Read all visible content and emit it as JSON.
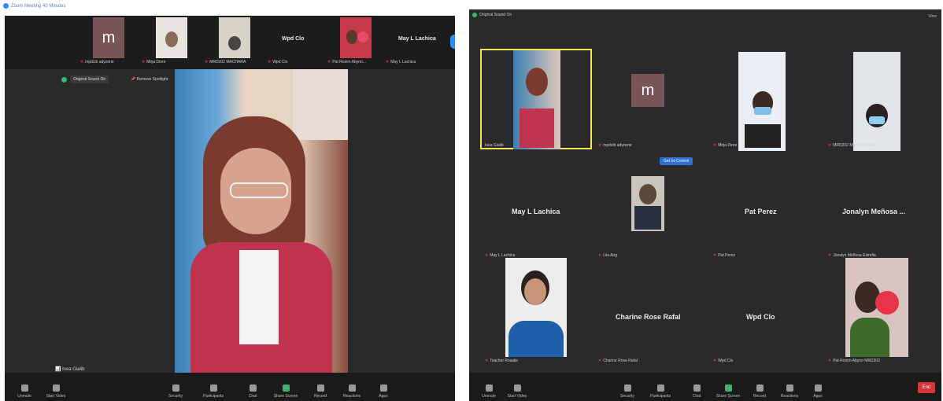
{
  "left": {
    "window_title": "Zoom Meeting 40 Minutes",
    "thumbs": [
      {
        "avatar_letter": "m",
        "name": "mpdcib adyzerie"
      },
      {
        "name": "Mirja Diore"
      },
      {
        "name": "MRD202 MACHARA"
      },
      {
        "big_name": "Wpd Clo",
        "name": "Wpd Clo"
      },
      {
        "name": "Pat Ronim Abyno..."
      },
      {
        "big_name": "May L Lachica",
        "name": "May L Lachica"
      }
    ],
    "original_sound": "Original Sound On",
    "remove_spotlight": "Remove Spotlight",
    "speaker_name": "Isea Gialib",
    "toolbar": [
      "Unmute",
      "Start Video",
      "Security",
      "Participants",
      "Chat",
      "Share Screen",
      "Record",
      "Reactions",
      "Apps"
    ],
    "participants_count": "11"
  },
  "right": {
    "original_sound": "Original Sound On",
    "view_label": "View",
    "cells": [
      {
        "name": "Isea Gialib"
      },
      {
        "avatar_letter": "m",
        "name": "mpdcib adyzerie"
      },
      {
        "name": "Mirja Diore"
      },
      {
        "name": "MRD202 Mac FMCARA"
      },
      {
        "big_name": "May L Lachica",
        "name": "May L Lachica"
      },
      {
        "name": "Lila Ang"
      },
      {
        "big_name": "Pat Perez",
        "name": "Pat Perez"
      },
      {
        "big_name": "Jonalyn Meñosa ...",
        "name": "Jonalyn Meñosa Estrella"
      },
      {
        "name": "Teacher Rosalie"
      },
      {
        "big_name": "Charine Rose Rafal",
        "name": "Charine Rose Rafal"
      },
      {
        "big_name": "Wpd Clo",
        "name": "Wpd Clo"
      },
      {
        "name": "Pat Ronim Abyno MRD202"
      }
    ],
    "banner": "Get Ini Control",
    "toolbar": [
      "Unmute",
      "Start Video",
      "Security",
      "Participants",
      "Chat",
      "Share Screen",
      "Record",
      "Reactions",
      "Apps"
    ],
    "participants_count": "11",
    "end_label": "End"
  },
  "colors": {
    "mic_muted": "#e03c3c",
    "share_green": "#3cb371",
    "end_red": "#d9343a",
    "spotlight_border": "#f2e85a"
  }
}
